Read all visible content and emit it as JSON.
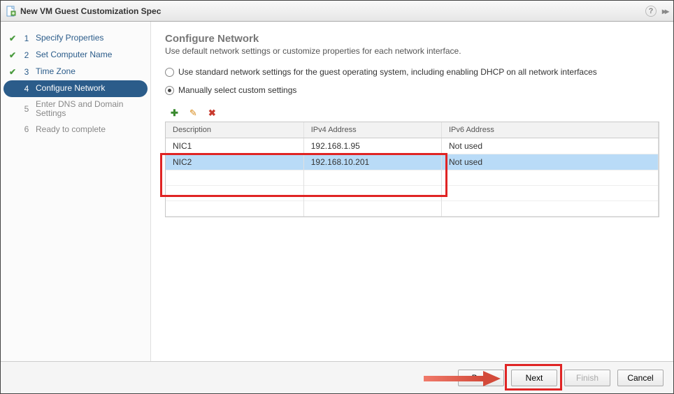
{
  "title": "New VM Guest Customization Spec",
  "steps": [
    {
      "label": "Specify Properties",
      "state": "done"
    },
    {
      "label": "Set Computer Name",
      "state": "done"
    },
    {
      "label": "Time Zone",
      "state": "done"
    },
    {
      "label": "Configure Network",
      "state": "active"
    },
    {
      "label": "Enter DNS and Domain Settings",
      "state": "pending"
    },
    {
      "label": "Ready to complete",
      "state": "pending"
    }
  ],
  "page": {
    "title": "Configure Network",
    "desc": "Use default network settings or customize properties for each network interface."
  },
  "options": {
    "standard": "Use standard network settings for the guest operating system, including enabling DHCP on all network interfaces",
    "manual": "Manually select custom settings"
  },
  "headers": {
    "desc": "Description",
    "ipv4": "IPv4 Address",
    "ipv6": "IPv6 Address"
  },
  "rows": [
    {
      "desc": "NIC1",
      "ipv4": "192.168.1.95",
      "ipv6": "Not used",
      "selected": false
    },
    {
      "desc": "NIC2",
      "ipv4": "192.168.10.201",
      "ipv6": "Not used",
      "selected": true
    }
  ],
  "buttons": {
    "back": "Back",
    "next": "Next",
    "finish": "Finish",
    "cancel": "Cancel"
  }
}
